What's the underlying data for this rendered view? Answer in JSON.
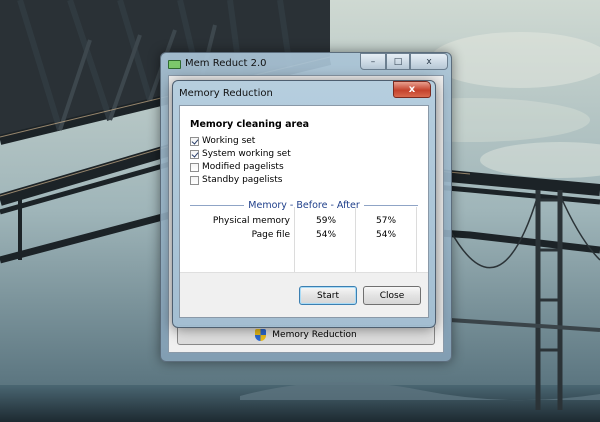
{
  "main_window": {
    "title": "Mem Reduct 2.0",
    "controls": {
      "minimize": "–",
      "maximize": "□",
      "close": "x"
    },
    "bottom_button_label": "Memory Reduction"
  },
  "dialog": {
    "title": "Memory Reduction",
    "close_glyph": "x",
    "group_title": "Memory cleaning area",
    "options": [
      {
        "label": "Working set",
        "checked": true
      },
      {
        "label": "System working set",
        "checked": true
      },
      {
        "label": "Modified pagelists",
        "checked": false
      },
      {
        "label": "Standby pagelists",
        "checked": false
      }
    ],
    "memory_header": "Memory - Before - After",
    "rows": [
      {
        "label": "Physical memory",
        "before": "59%",
        "after": "57%"
      },
      {
        "label": "Page file",
        "before": "54%",
        "after": "54%"
      }
    ],
    "start_label": "Start",
    "close_label": "Close"
  }
}
